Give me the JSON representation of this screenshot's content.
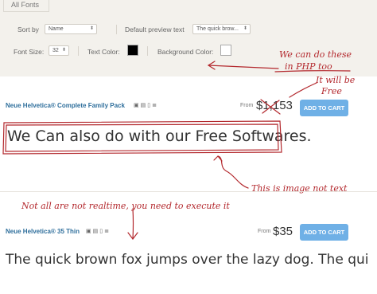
{
  "filters": {
    "tab_label": "All Fonts",
    "sort_by_label": "Sort by",
    "sort_by_value": "Name",
    "preview_text_label": "Default preview text",
    "preview_text_value": "The quick brow...",
    "font_size_label": "Font Size:",
    "font_size_value": "32",
    "text_color_label": "Text Color:",
    "text_color": "#000000",
    "background_color_label": "Background Color:",
    "background_color": "#ffffff"
  },
  "products": [
    {
      "name": "Neue Helvetica® Complete Family Pack",
      "from_label": "From",
      "price": "$1,153",
      "price_currency": "$",
      "price_digits": "1,153",
      "button_label": "ADD TO CART",
      "preview_text": "We Can also do with our Free Softwares."
    },
    {
      "name": "Neue Helvetica® 35 Thin",
      "from_label": "From",
      "price": "$35",
      "price_currency": "$",
      "price_digits": "35",
      "button_label": "ADD TO CART",
      "preview_text": "The quick brown fox jumps over the lazy dog. The qui"
    }
  ],
  "annotations": {
    "php_note_1": "We can do these",
    "php_note_2": "in PHP too",
    "free_note_1": "It will be",
    "free_note_2": "Free",
    "image_note": "This is image not text",
    "realtime_note": "Not all are not realtime, you need to execute it"
  },
  "colors": {
    "accent_blue": "#6fb0e6",
    "product_name_blue": "#2f6f9c",
    "annotation_red": "#b3282d",
    "panel_bg": "#f3f1ec"
  }
}
